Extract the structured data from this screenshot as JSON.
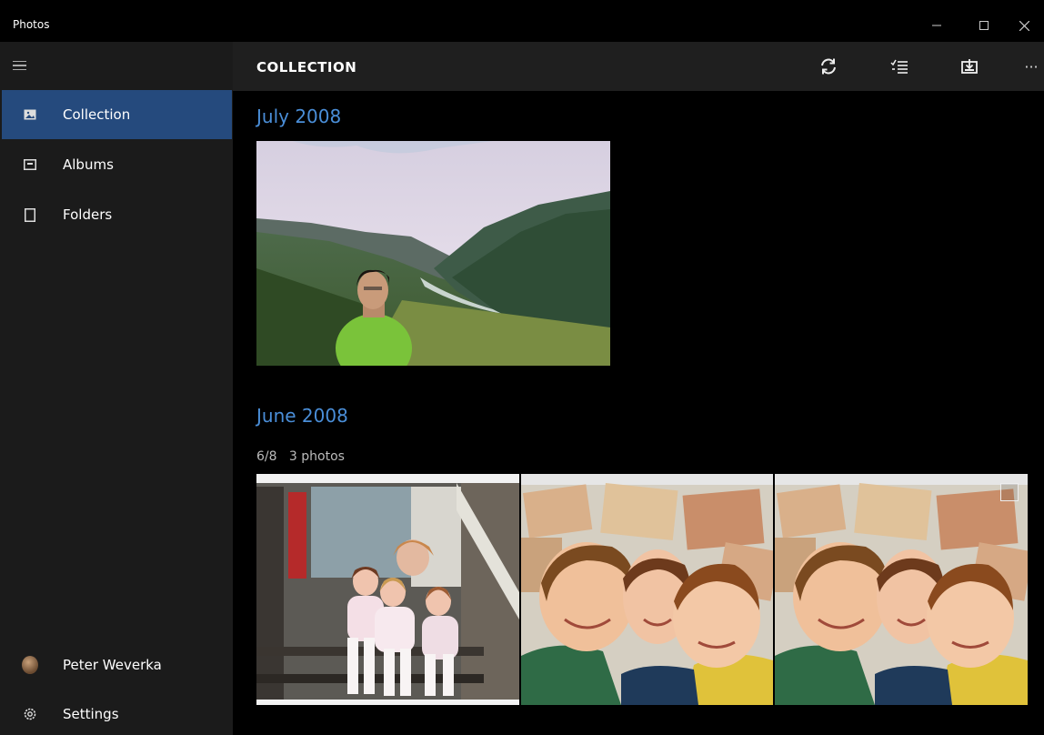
{
  "window": {
    "app_title": "Photos"
  },
  "sidebar": {
    "items": [
      {
        "label": "Collection",
        "icon": "photo-icon",
        "active": true
      },
      {
        "label": "Albums",
        "icon": "album-icon",
        "active": false
      },
      {
        "label": "Folders",
        "icon": "folder-icon",
        "active": false
      }
    ],
    "user": {
      "label": "Peter Weverka",
      "icon": "avatar"
    },
    "settings": {
      "label": "Settings",
      "icon": "gear-icon"
    }
  },
  "header": {
    "title": "COLLECTION",
    "actions": [
      "refresh-icon",
      "select-icon",
      "import-icon",
      "more-icon"
    ],
    "more_label": "···"
  },
  "content": {
    "groups": [
      {
        "month": "July 2008",
        "photos": [
          "mountain-valley-portrait"
        ]
      },
      {
        "month": "June 2008",
        "date": "6/8",
        "count": "3 photos",
        "photos": [
          "girls-on-stairs",
          "kids-faces",
          "kids-faces"
        ]
      }
    ]
  },
  "colors": {
    "accent": "#4a8ed8",
    "active_nav": "#254a7d",
    "sidebar_bg": "#1b1b1b",
    "header_bg": "#1f1f1f"
  }
}
